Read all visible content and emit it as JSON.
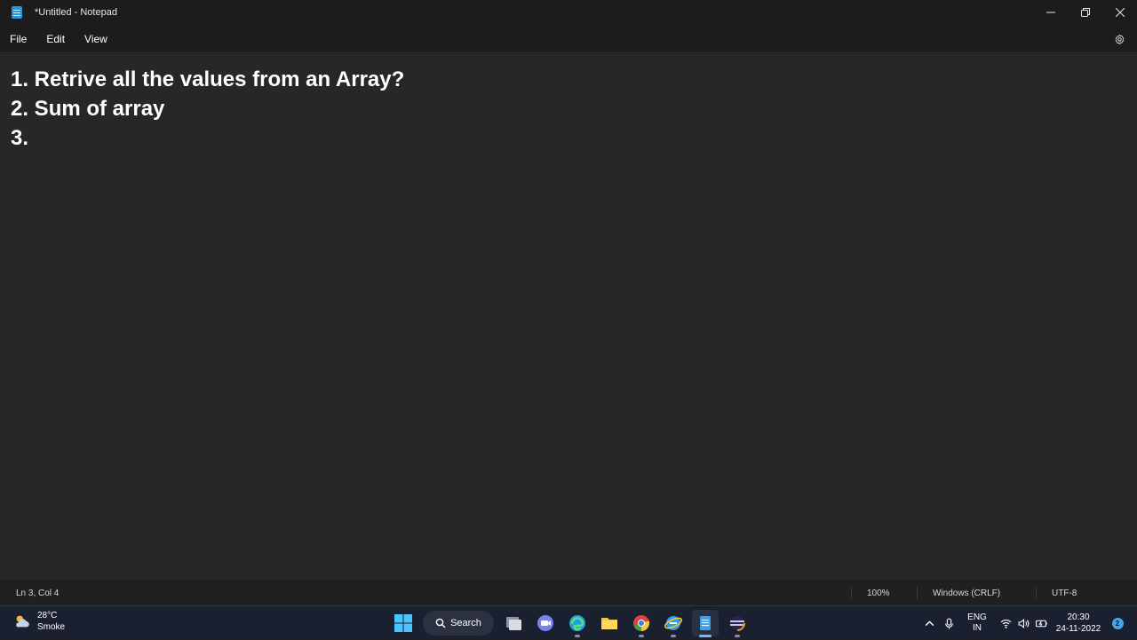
{
  "window": {
    "title": "*Untitled - Notepad",
    "minimize_label": "—",
    "accent": "#2b95d6"
  },
  "menu": {
    "items": [
      {
        "label": "File"
      },
      {
        "label": "Edit"
      },
      {
        "label": "View"
      }
    ]
  },
  "editor": {
    "lines": [
      "1. Retrive all the values from an Array?",
      "2. Sum of array",
      "3. "
    ]
  },
  "statusbar": {
    "position": "Ln 3, Col 4",
    "zoom": "100%",
    "line_ending": "Windows (CRLF)",
    "encoding": "UTF-8"
  },
  "taskbar": {
    "weather": {
      "temp": "28°C",
      "condition": "Smoke"
    },
    "search_label": "Search",
    "apps": [
      {
        "icon": "windows-start-icon"
      },
      {
        "icon": "task-view-icon"
      },
      {
        "icon": "teams-chat-icon"
      },
      {
        "icon": "edge-browser-icon"
      },
      {
        "icon": "file-explorer-icon"
      },
      {
        "icon": "chrome-icon"
      },
      {
        "icon": "internet-explorer-icon"
      },
      {
        "icon": "notepad-icon"
      },
      {
        "icon": "eclipse-icon"
      }
    ],
    "language": {
      "line1": "ENG",
      "line2": "IN"
    },
    "clock": {
      "time": "20:30",
      "date": "24-11-2022"
    },
    "notifications": "2"
  }
}
